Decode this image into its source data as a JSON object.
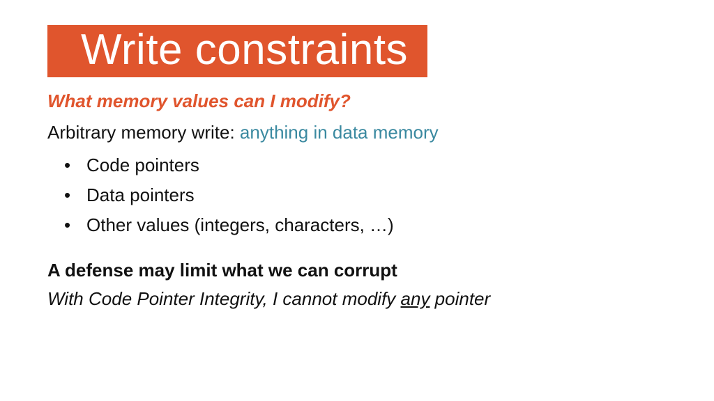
{
  "title": "Write constraints",
  "subtitle": "What memory values can I modify?",
  "arbitrary": {
    "prefix": "Arbitrary memory write: ",
    "highlight": "anything in data memory"
  },
  "bullets": [
    "Code pointers",
    "Data pointers",
    "Other values (integers, characters, …)"
  ],
  "defense_heading": "A defense may limit what we can corrupt",
  "cpi": {
    "prefix": "With Code Pointer Integrity, I cannot modify ",
    "underlined": "any",
    "suffix": " pointer"
  },
  "colors": {
    "accent": "#e0552d",
    "teal": "#3a89a0"
  }
}
